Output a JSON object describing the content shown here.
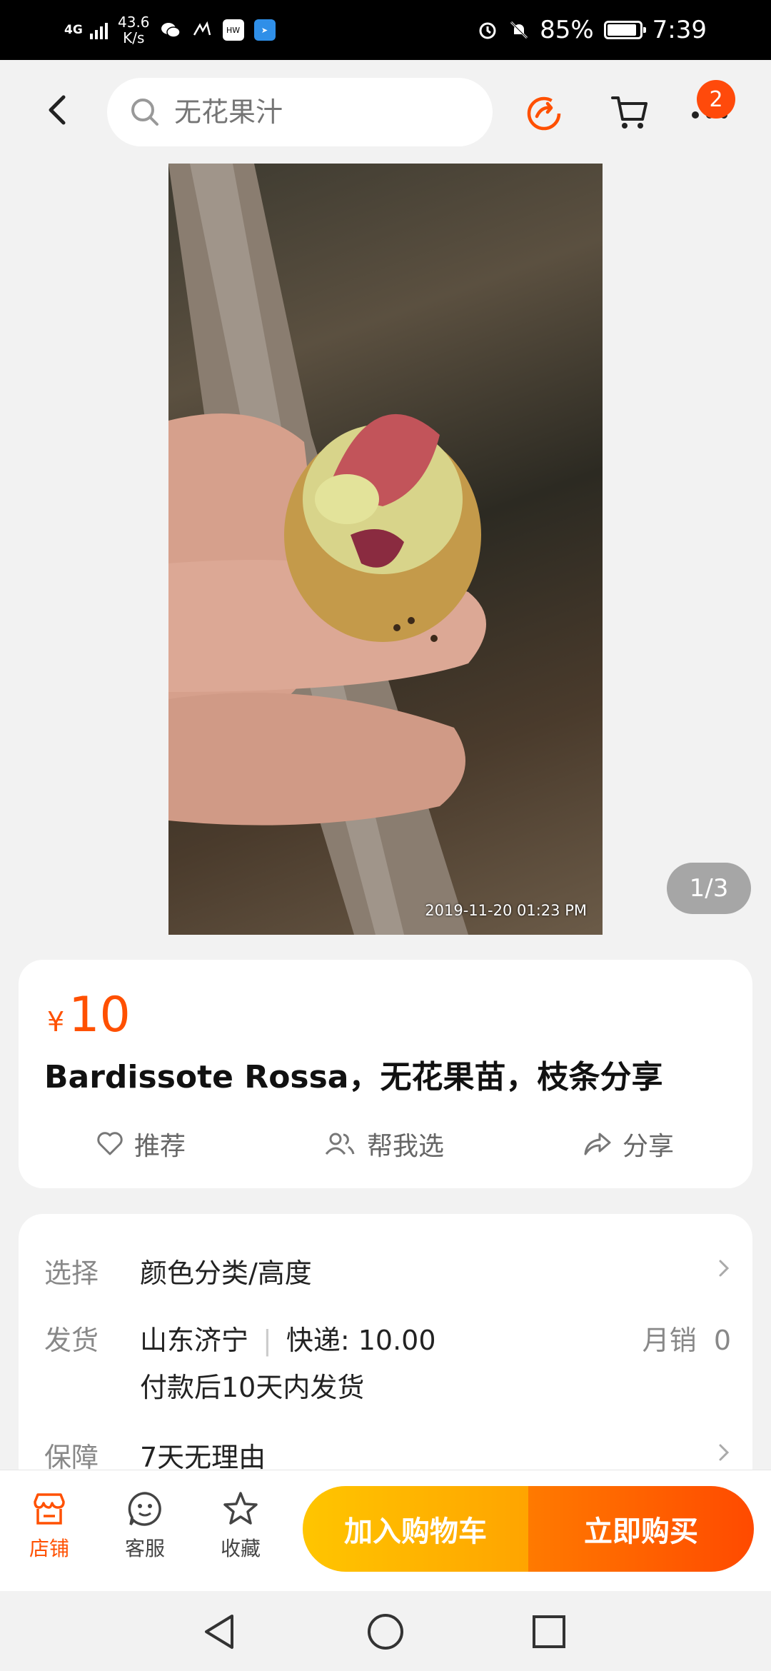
{
  "status_bar": {
    "network": "4G",
    "speed": "43.6\nK/s",
    "speed_value": "43.6",
    "speed_unit": "K/s",
    "battery": "85%",
    "battery_level": 0.85,
    "time": "7:39"
  },
  "header": {
    "search_placeholder": "无花果汁",
    "cart_badge": "2"
  },
  "gallery": {
    "timestamp": "2019-11-20 01:23 PM",
    "counter": "1/3"
  },
  "product": {
    "currency": "¥",
    "price": "10",
    "title": "Bardissote Rossa，无花果苗，枝条分享",
    "actions": {
      "recommend": "推荐",
      "help_choose": "帮我选",
      "share": "分享"
    }
  },
  "details": {
    "select": {
      "label": "选择",
      "value": "颜色分类/高度"
    },
    "shipping": {
      "label": "发货",
      "origin": "山东济宁",
      "express": "快递: 10.00",
      "monthly_sales": "月销  0",
      "note": "付款后10天内发货"
    },
    "guarantee": {
      "label": "保障",
      "value": "7天无理由"
    }
  },
  "bottom_bar": {
    "store": "店铺",
    "service": "客服",
    "favorite": "收藏",
    "add_to_cart": "加入购物车",
    "buy_now": "立即购买"
  },
  "colors": {
    "accent": "#ff5000",
    "cart_button": "#ffb300",
    "buy_button": "#ff5a00"
  }
}
